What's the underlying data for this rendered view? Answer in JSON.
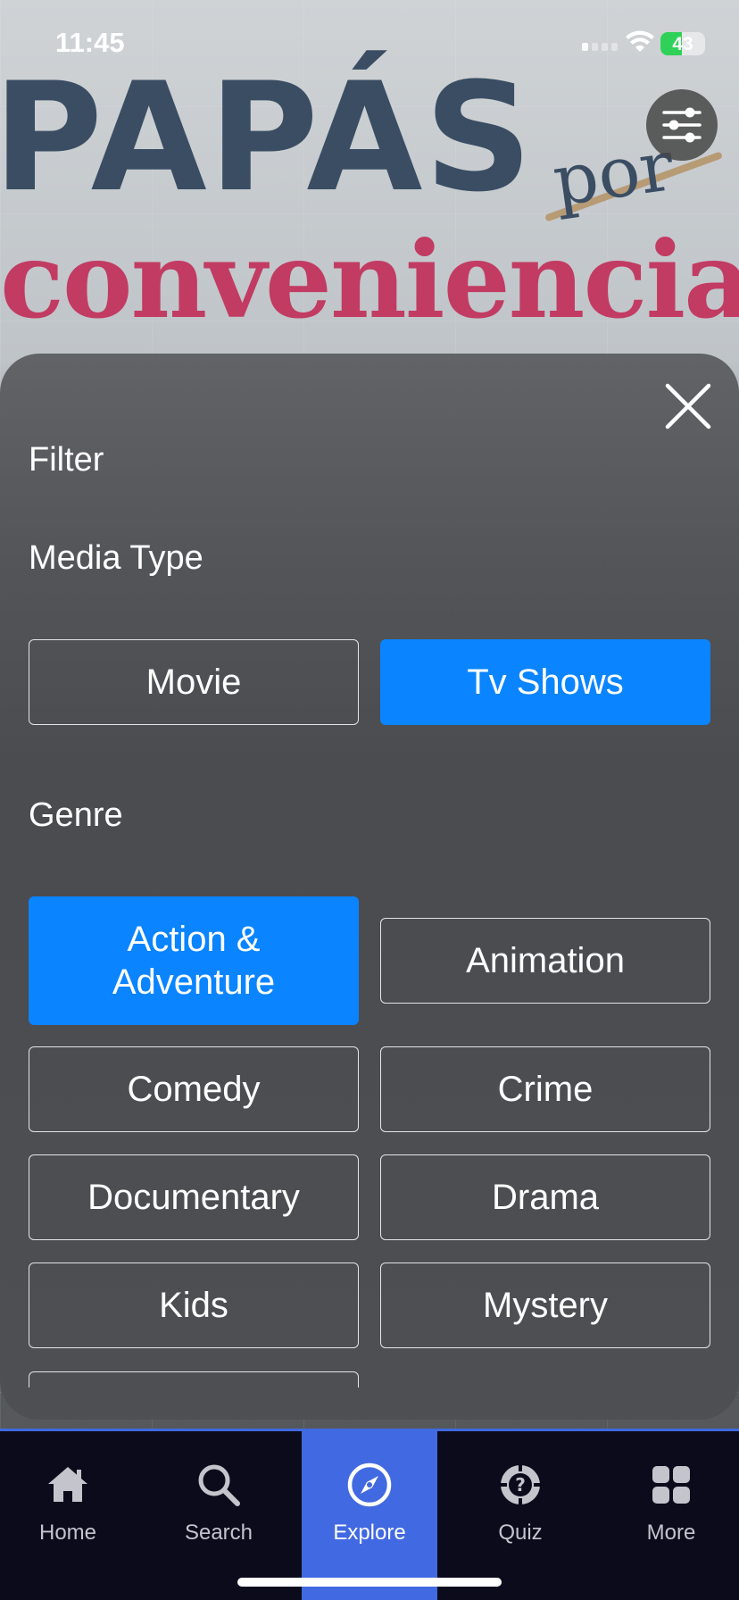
{
  "status_bar": {
    "time": "11:45",
    "battery": "43"
  },
  "poster": {
    "line1": "PAPÁS",
    "line2": "conveniencia",
    "por": "por"
  },
  "sheet": {
    "title": "Filter",
    "media_type": {
      "heading": "Media Type",
      "options": [
        {
          "label": "Movie",
          "selected": false
        },
        {
          "label": "Tv Shows",
          "selected": true
        }
      ]
    },
    "genre": {
      "heading": "Genre",
      "options": [
        {
          "label": "Action & Adventure",
          "selected": true
        },
        {
          "label": "Animation",
          "selected": false
        },
        {
          "label": "Comedy",
          "selected": false
        },
        {
          "label": "Crime",
          "selected": false
        },
        {
          "label": "Documentary",
          "selected": false
        },
        {
          "label": "Drama",
          "selected": false
        },
        {
          "label": "Kids",
          "selected": false
        },
        {
          "label": "Mystery",
          "selected": false
        }
      ]
    }
  },
  "tabs": [
    {
      "label": "Home",
      "icon": "home-icon",
      "active": false
    },
    {
      "label": "Search",
      "icon": "search-icon",
      "active": false
    },
    {
      "label": "Explore",
      "icon": "compass-icon",
      "active": true
    },
    {
      "label": "Quiz",
      "icon": "quiz-icon",
      "active": false
    },
    {
      "label": "More",
      "icon": "grid-icon",
      "active": false
    }
  ],
  "colors": {
    "accent": "#0a84ff",
    "tab_active": "#4169e1",
    "tab_bar": "#0b0b1c"
  }
}
